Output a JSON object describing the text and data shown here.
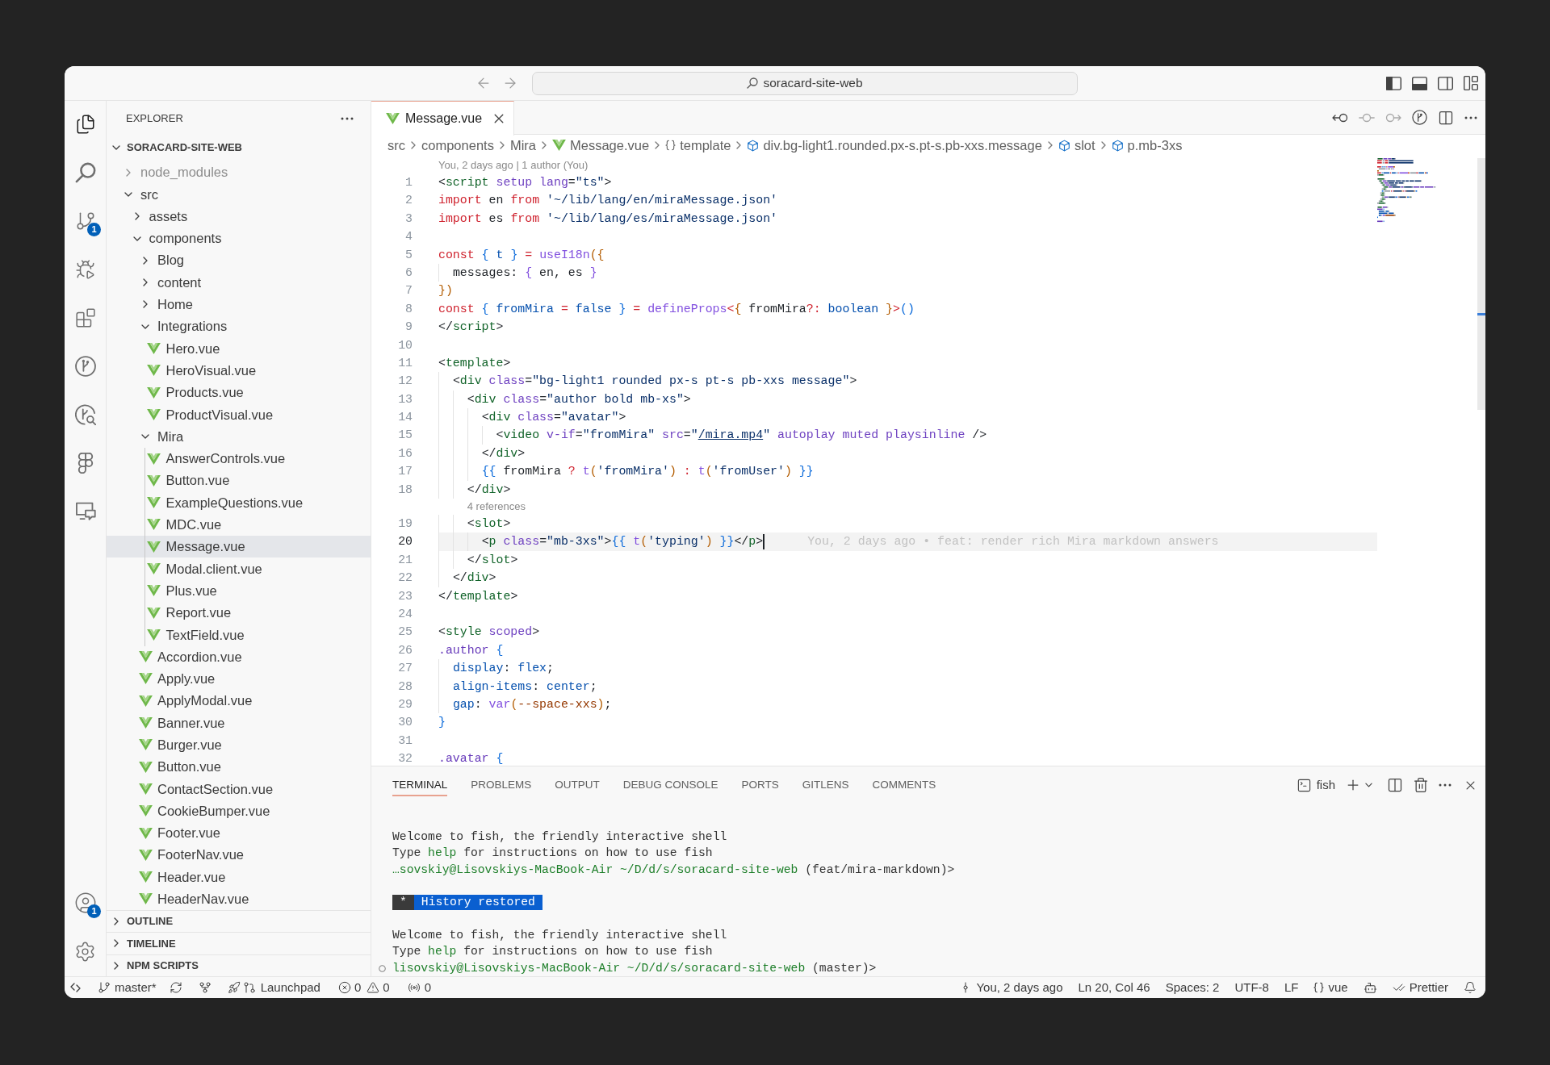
{
  "window": {
    "command_center": "soracard-site-web",
    "layout_toggles": [
      {
        "on": true
      },
      {
        "on": true
      },
      {
        "on": false
      }
    ]
  },
  "activity_bar": {
    "items": [
      {
        "selected": true
      },
      {
        "selected": false
      },
      {
        "selected": false,
        "badge": "1"
      },
      {
        "selected": false
      },
      {
        "selected": false
      },
      {
        "selected": false
      },
      {
        "selected": false
      },
      {
        "selected": false
      },
      {
        "selected": false
      }
    ],
    "account_badge": "1"
  },
  "sidebar": {
    "title": "EXPLORER",
    "root": {
      "label": "SORACARD-SITE-WEB",
      "expanded": true
    },
    "tree": [
      {
        "name": "node_modules",
        "kind": "folder",
        "expanded": false,
        "selected": false,
        "ignored": true
      },
      {
        "name": "src",
        "kind": "folder",
        "expanded": true,
        "selected": false,
        "ignored": false,
        "children": [
          {
            "name": "assets",
            "kind": "folder",
            "expanded": false,
            "selected": false
          },
          {
            "name": "components",
            "kind": "folder",
            "expanded": true,
            "selected": false,
            "children": [
              {
                "name": "Blog",
                "kind": "folder",
                "expanded": false,
                "selected": false
              },
              {
                "name": "content",
                "kind": "folder",
                "expanded": false,
                "selected": false
              },
              {
                "name": "Home",
                "kind": "folder",
                "expanded": false,
                "selected": false
              },
              {
                "name": "Integrations",
                "kind": "folder",
                "expanded": true,
                "selected": false,
                "children": [
                  {
                    "name": "Hero.vue",
                    "kind": "vue",
                    "selected": false
                  },
                  {
                    "name": "HeroVisual.vue",
                    "kind": "vue",
                    "selected": false
                  },
                  {
                    "name": "Products.vue",
                    "kind": "vue",
                    "selected": false
                  },
                  {
                    "name": "ProductVisual.vue",
                    "kind": "vue",
                    "selected": false
                  }
                ]
              },
              {
                "name": "Mira",
                "kind": "folder",
                "expanded": true,
                "selected": false,
                "children": [
                  {
                    "name": "AnswerControls.vue",
                    "kind": "vue",
                    "selected": false
                  },
                  {
                    "name": "Button.vue",
                    "kind": "vue",
                    "selected": false
                  },
                  {
                    "name": "ExampleQuestions.vue",
                    "kind": "vue",
                    "selected": false
                  },
                  {
                    "name": "MDC.vue",
                    "kind": "vue",
                    "selected": false
                  },
                  {
                    "name": "Message.vue",
                    "kind": "vue",
                    "selected": true
                  },
                  {
                    "name": "Modal.client.vue",
                    "kind": "vue",
                    "selected": false
                  },
                  {
                    "name": "Plus.vue",
                    "kind": "vue",
                    "selected": false
                  },
                  {
                    "name": "Report.vue",
                    "kind": "vue",
                    "selected": false
                  },
                  {
                    "name": "TextField.vue",
                    "kind": "vue",
                    "selected": false
                  }
                ]
              },
              {
                "name": "Accordion.vue",
                "kind": "vue",
                "selected": false
              },
              {
                "name": "Apply.vue",
                "kind": "vue",
                "selected": false
              },
              {
                "name": "ApplyModal.vue",
                "kind": "vue",
                "selected": false
              },
              {
                "name": "Banner.vue",
                "kind": "vue",
                "selected": false
              },
              {
                "name": "Burger.vue",
                "kind": "vue",
                "selected": false
              },
              {
                "name": "Button.vue",
                "kind": "vue",
                "selected": false
              },
              {
                "name": "ContactSection.vue",
                "kind": "vue",
                "selected": false
              },
              {
                "name": "CookieBumper.vue",
                "kind": "vue",
                "selected": false
              },
              {
                "name": "Footer.vue",
                "kind": "vue",
                "selected": false
              },
              {
                "name": "FooterNav.vue",
                "kind": "vue",
                "selected": false
              },
              {
                "name": "Header.vue",
                "kind": "vue",
                "selected": false
              },
              {
                "name": "HeaderNav.vue",
                "kind": "vue",
                "selected": false
              }
            ]
          }
        ]
      }
    ],
    "sections": [
      {
        "title": "OUTLINE",
        "expanded": false
      },
      {
        "title": "TIMELINE",
        "expanded": false
      },
      {
        "title": "NPM SCRIPTS",
        "expanded": false
      }
    ]
  },
  "editor": {
    "tabs": [
      {
        "label": "Message.vue",
        "kind": "vue",
        "selected": true
      }
    ],
    "breadcrumbs": [
      {
        "label": "src",
        "kind": "folder"
      },
      {
        "label": "components",
        "kind": "folder"
      },
      {
        "label": "Mira",
        "kind": "folder"
      },
      {
        "label": "Message.vue",
        "kind": "vue"
      },
      {
        "label": "template",
        "kind": "namespace"
      },
      {
        "label": "div.bg-light1.rounded.px-s.pt-s.pb-xxs.message",
        "kind": "element"
      },
      {
        "label": "slot",
        "kind": "element"
      },
      {
        "label": "p.mb-3xs",
        "kind": "element"
      }
    ],
    "lines": [
      {
        "kind": "lens",
        "text": "You, 2 days ago | 1 author (You)"
      },
      {
        "kind": "code",
        "number": "1",
        "active": false,
        "tokens": [
          {
            "kind": "p",
            "text": "<"
          },
          {
            "kind": "tag",
            "text": "script"
          },
          {
            "kind": "attr",
            "text": " setup lang"
          },
          {
            "kind": "p",
            "text": "="
          },
          {
            "kind": "str",
            "text": "\"ts\""
          },
          {
            "kind": "p",
            "text": ">"
          }
        ]
      },
      {
        "kind": "code",
        "number": "2",
        "active": false,
        "tokens": [
          {
            "kind": "kw",
            "text": "import"
          },
          {
            "kind": "p",
            "text": " en "
          },
          {
            "kind": "kw",
            "text": "from"
          },
          {
            "kind": "str",
            "text": " '~/lib/lang/en/miraMessage.json'"
          }
        ]
      },
      {
        "kind": "code",
        "number": "3",
        "active": false,
        "tokens": [
          {
            "kind": "kw",
            "text": "import"
          },
          {
            "kind": "p",
            "text": " es "
          },
          {
            "kind": "kw",
            "text": "from"
          },
          {
            "kind": "str",
            "text": " '~/lib/lang/es/miraMessage.json'"
          }
        ]
      },
      {
        "kind": "code",
        "number": "4",
        "active": false
      },
      {
        "kind": "code",
        "number": "5",
        "active": false,
        "tokens": [
          {
            "kind": "kw",
            "text": "const"
          },
          {
            "kind": "b1",
            "text": " {"
          },
          {
            "kind": "const",
            "text": " t "
          },
          {
            "kind": "b1",
            "text": "}"
          },
          {
            "kind": "kw",
            "text": " = "
          },
          {
            "kind": "fn",
            "text": "useI18n"
          },
          {
            "kind": "b2",
            "text": "({"
          }
        ]
      },
      {
        "kind": "code",
        "number": "6",
        "active": false,
        "tokens": [
          {
            "kind": "p",
            "text": "  messages: "
          },
          {
            "kind": "b3",
            "text": "{"
          },
          {
            "kind": "p",
            "text": " en, es "
          },
          {
            "kind": "b3",
            "text": "}"
          }
        ]
      },
      {
        "kind": "code",
        "number": "7",
        "active": false,
        "tokens": [
          {
            "kind": "b2",
            "text": "})"
          }
        ]
      },
      {
        "kind": "code",
        "number": "8",
        "active": false,
        "tokens": [
          {
            "kind": "kw",
            "text": "const"
          },
          {
            "kind": "b1",
            "text": " {"
          },
          {
            "kind": "const",
            "text": " fromMira "
          },
          {
            "kind": "kw",
            "text": "="
          },
          {
            "kind": "const",
            "text": " false "
          },
          {
            "kind": "b1",
            "text": "}"
          },
          {
            "kind": "kw",
            "text": " = "
          },
          {
            "kind": "fn",
            "text": "defineProps"
          },
          {
            "kind": "kw",
            "text": "<"
          },
          {
            "kind": "b2",
            "text": "{"
          },
          {
            "kind": "p",
            "text": " fromMira"
          },
          {
            "kind": "kw",
            "text": "?:"
          },
          {
            "kind": "const",
            "text": " boolean "
          },
          {
            "kind": "b2",
            "text": "}"
          },
          {
            "kind": "kw",
            "text": ">"
          },
          {
            "kind": "b1",
            "text": "()"
          }
        ]
      },
      {
        "kind": "code",
        "number": "9",
        "active": false,
        "tokens": [
          {
            "kind": "p",
            "text": "</"
          },
          {
            "kind": "tag",
            "text": "script"
          },
          {
            "kind": "p",
            "text": ">"
          }
        ]
      },
      {
        "kind": "code",
        "number": "10",
        "active": false
      },
      {
        "kind": "code",
        "number": "11",
        "active": false,
        "tokens": [
          {
            "kind": "p",
            "text": "<"
          },
          {
            "kind": "tag",
            "text": "template"
          },
          {
            "kind": "p",
            "text": ">"
          }
        ]
      },
      {
        "kind": "code",
        "number": "12",
        "active": false,
        "tokens": [
          {
            "kind": "p",
            "text": "  <"
          },
          {
            "kind": "tag",
            "text": "div"
          },
          {
            "kind": "attr",
            "text": " class"
          },
          {
            "kind": "p",
            "text": "="
          },
          {
            "kind": "str",
            "text": "\"bg-light1 rounded px-s pt-s pb-xxs message\""
          },
          {
            "kind": "p",
            "text": ">"
          }
        ]
      },
      {
        "kind": "code",
        "number": "13",
        "active": false,
        "tokens": [
          {
            "kind": "p",
            "text": "    <"
          },
          {
            "kind": "tag",
            "text": "div"
          },
          {
            "kind": "attr",
            "text": " class"
          },
          {
            "kind": "p",
            "text": "="
          },
          {
            "kind": "str",
            "text": "\"author bold mb-xs\""
          },
          {
            "kind": "p",
            "text": ">"
          }
        ]
      },
      {
        "kind": "code",
        "number": "14",
        "active": false,
        "tokens": [
          {
            "kind": "p",
            "text": "      <"
          },
          {
            "kind": "tag",
            "text": "div"
          },
          {
            "kind": "attr",
            "text": " class"
          },
          {
            "kind": "p",
            "text": "="
          },
          {
            "kind": "str",
            "text": "\"avatar\""
          },
          {
            "kind": "p",
            "text": ">"
          }
        ]
      },
      {
        "kind": "code",
        "number": "15",
        "active": false,
        "tokens": [
          {
            "kind": "p",
            "text": "        <"
          },
          {
            "kind": "tag",
            "text": "video"
          },
          {
            "kind": "attr",
            "text": " v-if"
          },
          {
            "kind": "p",
            "text": "="
          },
          {
            "kind": "str",
            "text": "\"fromMira\""
          },
          {
            "kind": "attr",
            "text": " src"
          },
          {
            "kind": "p",
            "text": "="
          },
          {
            "kind": "str",
            "text": "\""
          },
          {
            "kind": "link",
            "text": "/mira.mp4"
          },
          {
            "kind": "str",
            "text": "\""
          },
          {
            "kind": "attr",
            "text": " autoplay muted playsinline"
          },
          {
            "kind": "p",
            "text": " />"
          }
        ]
      },
      {
        "kind": "code",
        "number": "16",
        "active": false,
        "tokens": [
          {
            "kind": "p",
            "text": "      </"
          },
          {
            "kind": "tag",
            "text": "div"
          },
          {
            "kind": "p",
            "text": ">"
          }
        ]
      },
      {
        "kind": "code",
        "number": "17",
        "active": false,
        "tokens": [
          {
            "kind": "b1",
            "text": "      {{"
          },
          {
            "kind": "p",
            "text": " fromMira "
          },
          {
            "kind": "kw",
            "text": "?"
          },
          {
            "kind": "fn",
            "text": " t"
          },
          {
            "kind": "b2",
            "text": "("
          },
          {
            "kind": "str",
            "text": "'fromMira'"
          },
          {
            "kind": "b2",
            "text": ")"
          },
          {
            "kind": "kw",
            "text": " :"
          },
          {
            "kind": "fn",
            "text": " t"
          },
          {
            "kind": "b2",
            "text": "("
          },
          {
            "kind": "str",
            "text": "'fromUser'"
          },
          {
            "kind": "b2",
            "text": ")"
          },
          {
            "kind": "b1",
            "text": " }}"
          }
        ]
      },
      {
        "kind": "code",
        "number": "18",
        "active": false,
        "tokens": [
          {
            "kind": "p",
            "text": "    </"
          },
          {
            "kind": "tag",
            "text": "div"
          },
          {
            "kind": "p",
            "text": ">"
          }
        ]
      },
      {
        "kind": "lens",
        "text": "4 references"
      },
      {
        "kind": "code",
        "number": "19",
        "active": false,
        "tokens": [
          {
            "kind": "p",
            "text": "    <"
          },
          {
            "kind": "tag",
            "text": "slot"
          },
          {
            "kind": "p",
            "text": ">"
          }
        ]
      },
      {
        "kind": "code",
        "number": "20",
        "active": true,
        "blame": "You, 2 days ago • feat: render rich Mira markdown answers",
        "tokens": [
          {
            "kind": "p",
            "text": "      <"
          },
          {
            "kind": "tag",
            "text": "p"
          },
          {
            "kind": "attr",
            "text": " class"
          },
          {
            "kind": "p",
            "text": "="
          },
          {
            "kind": "str",
            "text": "\"mb-3xs\""
          },
          {
            "kind": "p",
            "text": ">"
          },
          {
            "kind": "b1",
            "text": "{{"
          },
          {
            "kind": "fn",
            "text": " t"
          },
          {
            "kind": "b2",
            "text": "("
          },
          {
            "kind": "str",
            "text": "'typing'"
          },
          {
            "kind": "b2",
            "text": ")"
          },
          {
            "kind": "b1",
            "text": " }}"
          },
          {
            "kind": "p",
            "text": "</"
          },
          {
            "kind": "tag",
            "text": "p"
          },
          {
            "kind": "p",
            "text": ">"
          }
        ]
      },
      {
        "kind": "code",
        "number": "21",
        "active": false,
        "tokens": [
          {
            "kind": "p",
            "text": "    </"
          },
          {
            "kind": "tag",
            "text": "slot"
          },
          {
            "kind": "p",
            "text": ">"
          }
        ]
      },
      {
        "kind": "code",
        "number": "22",
        "active": false,
        "tokens": [
          {
            "kind": "p",
            "text": "  </"
          },
          {
            "kind": "tag",
            "text": "div"
          },
          {
            "kind": "p",
            "text": ">"
          }
        ]
      },
      {
        "kind": "code",
        "number": "23",
        "active": false,
        "tokens": [
          {
            "kind": "p",
            "text": "</"
          },
          {
            "kind": "tag",
            "text": "template"
          },
          {
            "kind": "p",
            "text": ">"
          }
        ]
      },
      {
        "kind": "code",
        "number": "24",
        "active": false
      },
      {
        "kind": "code",
        "number": "25",
        "active": false,
        "tokens": [
          {
            "kind": "p",
            "text": "<"
          },
          {
            "kind": "tag",
            "text": "style"
          },
          {
            "kind": "attr",
            "text": " scoped"
          },
          {
            "kind": "p",
            "text": ">"
          }
        ]
      },
      {
        "kind": "code",
        "number": "26",
        "active": false,
        "tokens": [
          {
            "kind": "sel",
            "text": ".author"
          },
          {
            "kind": "b1",
            "text": " {"
          }
        ]
      },
      {
        "kind": "code",
        "number": "27",
        "active": false,
        "tokens": [
          {
            "kind": "prop",
            "text": "  display"
          },
          {
            "kind": "p",
            "text": ": "
          },
          {
            "kind": "const",
            "text": "flex"
          },
          {
            "kind": "p",
            "text": ";"
          }
        ]
      },
      {
        "kind": "code",
        "number": "28",
        "active": false,
        "tokens": [
          {
            "kind": "prop",
            "text": "  align-items"
          },
          {
            "kind": "p",
            "text": ": "
          },
          {
            "kind": "const",
            "text": "center"
          },
          {
            "kind": "p",
            "text": ";"
          }
        ]
      },
      {
        "kind": "code",
        "number": "29",
        "active": false,
        "tokens": [
          {
            "kind": "prop",
            "text": "  gap"
          },
          {
            "kind": "p",
            "text": ": "
          },
          {
            "kind": "fn",
            "text": "var"
          },
          {
            "kind": "b2",
            "text": "("
          },
          {
            "kind": "var",
            "text": "--space-xxs"
          },
          {
            "kind": "b2",
            "text": ")"
          },
          {
            "kind": "p",
            "text": ";"
          }
        ]
      },
      {
        "kind": "code",
        "number": "30",
        "active": false,
        "tokens": [
          {
            "kind": "b1",
            "text": "}"
          }
        ]
      },
      {
        "kind": "code",
        "number": "31",
        "active": false
      },
      {
        "kind": "code",
        "number": "32",
        "active": false,
        "tokens": [
          {
            "kind": "sel",
            "text": ".avatar"
          },
          {
            "kind": "b1",
            "text": " {"
          }
        ]
      }
    ]
  },
  "panel": {
    "tabs": [
      {
        "label": "TERMINAL",
        "selected": true
      },
      {
        "label": "PROBLEMS",
        "selected": false
      },
      {
        "label": "OUTPUT",
        "selected": false
      },
      {
        "label": "DEBUG CONSOLE",
        "selected": false
      },
      {
        "label": "PORTS",
        "selected": false
      },
      {
        "label": "GITLENS",
        "selected": false
      },
      {
        "label": "COMMENTS",
        "selected": false
      }
    ],
    "shell": "fish",
    "terminal": [
      {
        "kind": "lines",
        "lines": [
          {
            "decorated": false,
            "segments": [
              {
                "kind": "out",
                "text": "Welcome to fish, the friendly interactive shell"
              }
            ]
          },
          {
            "decorated": false,
            "segments": [
              {
                "kind": "out",
                "text": "Type "
              },
              {
                "kind": "cmd",
                "text": "help"
              },
              {
                "kind": "out",
                "text": " for instructions on how to use fish"
              }
            ]
          },
          {
            "decorated": false,
            "segments": [
              {
                "kind": "host",
                "text": "…sovskiy@Lisovskiys-MacBook-Air"
              },
              {
                "kind": "cwd",
                "text": " ~/D/d/s/soracard-site-web"
              },
              {
                "kind": "out",
                "text": " (feat/mira-markdown)>"
              }
            ]
          }
        ]
      },
      {
        "kind": "banner",
        "marker": "*",
        "text": "History restored"
      },
      {
        "kind": "lines",
        "lines": [
          {
            "decorated": false,
            "segments": [
              {
                "kind": "out",
                "text": "Welcome to fish, the friendly interactive shell"
              }
            ]
          },
          {
            "decorated": false,
            "segments": [
              {
                "kind": "out",
                "text": "Type "
              },
              {
                "kind": "cmd",
                "text": "help"
              },
              {
                "kind": "out",
                "text": " for instructions on how to use fish"
              }
            ]
          },
          {
            "decorated": true,
            "segments": [
              {
                "kind": "host",
                "text": "lisovskiy@Lisovskiys-MacBook-Air"
              },
              {
                "kind": "cwd",
                "text": " ~/D/d/s/soracard-site-web"
              },
              {
                "kind": "out",
                "text": " (master)>"
              }
            ]
          }
        ]
      }
    ]
  },
  "status_bar": {
    "branch": "master*",
    "launchpad": "Launchpad",
    "errors": "0",
    "warnings": "0",
    "ports": "0",
    "blame": "You, 2 days ago",
    "position": "Ln 20, Col 46",
    "indentation": "Spaces: 2",
    "encoding": "UTF-8",
    "eol": "LF",
    "language": "vue",
    "formatter": "Prettier"
  }
}
